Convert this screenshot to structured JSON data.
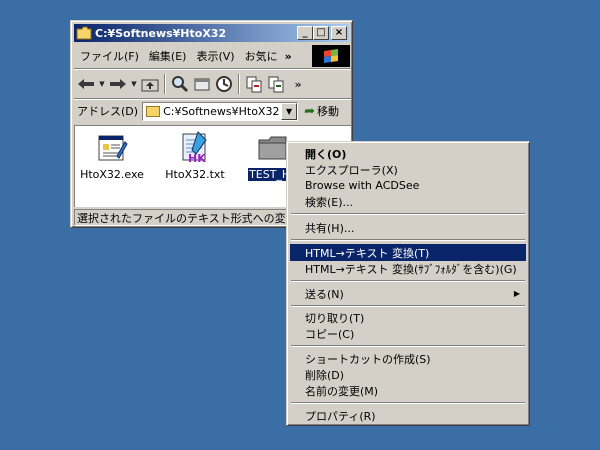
{
  "window": {
    "title": "C:¥Softnews¥HtoX32",
    "buttons": {
      "minimize": "_",
      "maximize": "□",
      "close": "×"
    }
  },
  "menubar": {
    "items": [
      "ファイル(F)",
      "編集(E)",
      "表示(V)",
      "お気に"
    ],
    "overflow": "»"
  },
  "toolbar": {
    "icons": [
      "back-icon",
      "forward-icon",
      "up-folder-icon",
      "search-icon",
      "folders-icon",
      "history-icon",
      "move-to-icon",
      "copy-to-icon"
    ],
    "overflow": "»"
  },
  "address": {
    "label": "アドレス(D)",
    "value": "C:¥Softnews¥HtoX32",
    "go_label": "移動"
  },
  "files": [
    {
      "name": "HtoX32.exe",
      "icon": "exe-icon"
    },
    {
      "name": "HtoX32.txt",
      "icon": "text-file-icon"
    },
    {
      "name": "TEST_HT",
      "icon": "folder-icon",
      "selected": true
    }
  ],
  "status": "選択されたファイルのテキスト形式への変換",
  "context_menu": [
    {
      "label": "開く(O)",
      "bold": true
    },
    {
      "label": "エクスプローラ(X)"
    },
    {
      "label": "Browse with ACDSee"
    },
    {
      "label": "検索(E)..."
    },
    {
      "label": "共有(H)..."
    },
    {
      "label": "HTML→テキスト 変換(T)",
      "highlighted": true
    },
    {
      "label": "HTML→テキスト 変換(ｻﾌﾞﾌｫﾙﾀﾞを含む)(G)"
    },
    {
      "label": "送る(N)",
      "submenu": true
    },
    {
      "label": "切り取り(T)"
    },
    {
      "label": "コピー(C)"
    },
    {
      "label": "ショートカットの作成(S)"
    },
    {
      "label": "削除(D)"
    },
    {
      "label": "名前の変更(M)"
    },
    {
      "label": "プロパティ(R)"
    }
  ],
  "colors": {
    "desktop": "#3a6ea5",
    "titlebar_start": "#0a246a",
    "titlebar_end": "#a6caf0",
    "highlight": "#0a246a",
    "face": "#d4d0c8"
  }
}
